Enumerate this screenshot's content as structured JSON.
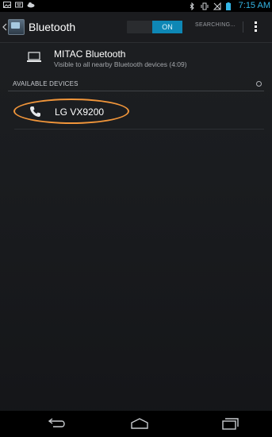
{
  "status_bar": {
    "time": "7:15 AM",
    "icons": [
      "picture-icon",
      "keyboard-icon",
      "cloud-icon",
      "bluetooth-icon",
      "vibrate-icon",
      "no-signal-icon",
      "battery-icon"
    ]
  },
  "action_bar": {
    "title": "Bluetooth",
    "toggle_label": "ON",
    "status_label": "SEARCHING..."
  },
  "own_device": {
    "name": "MITAC Bluetooth",
    "subtitle": "Visible to all nearby Bluetooth devices (4:09)"
  },
  "available": {
    "header": "AVAILABLE DEVICES",
    "devices": [
      {
        "name": "LG VX9200",
        "icon": "phone-icon"
      }
    ]
  },
  "colors": {
    "accent": "#33b5e5",
    "toggle_on": "#0e87b5",
    "highlight": "#f0953a"
  },
  "nav_bar": {
    "buttons": [
      "back-icon",
      "home-icon",
      "recent-apps-icon"
    ]
  }
}
